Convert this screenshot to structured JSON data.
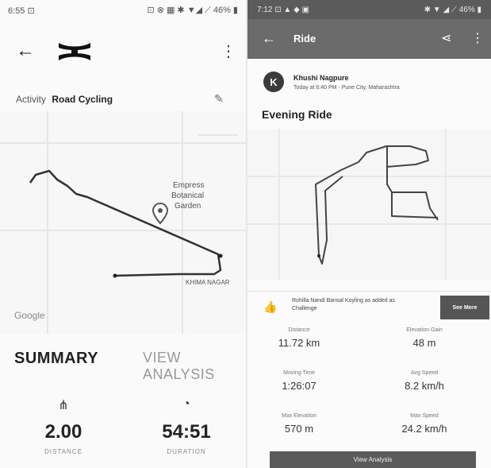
{
  "left": {
    "status": {
      "time": "6:55",
      "icons": "⊡",
      "right": "⊡ ⊗ ▦ ✱ ▼◢ ⟋ 46% ▮"
    },
    "activity_label": "Activity",
    "activity_value": "Road Cycling",
    "map": {
      "place_1": "Empress Botanical Garden",
      "place_1_lines": [
        "Empress",
        "Botanical",
        "Garden"
      ],
      "place_2": "KHIMA NAGAR",
      "google": "Google"
    },
    "summary_label": "SUMMARY",
    "view_analysis": "VIEW ANALYSIS",
    "stats": [
      {
        "icon": "route-icon",
        "value": "2.00",
        "label": "DISTANCE"
      },
      {
        "icon": "clock-icon",
        "value": "54:51",
        "label": "DURATION"
      }
    ]
  },
  "right": {
    "status": {
      "time": "7:12",
      "icons": "⊡ ▲ ◆ ▣",
      "right": "✱ ▼ ◢ ⟋ 46% ▮"
    },
    "title": "Ride",
    "avatar_letter": "K",
    "athlete_name": "Khushi Nagpure",
    "athlete_meta": "Today at 6:40 PM · Pune City, Maharashtra",
    "ride_title": "Evening Ride",
    "challenge_text": "Rohilla Nandi Bansal Koyling as added as Challenge",
    "see_button": "See More",
    "stats": [
      {
        "label": "Distance",
        "value": "11.72 km"
      },
      {
        "label": "Elevation Gain",
        "value": "48 m"
      },
      {
        "label": "Moving Time",
        "value": "1:26:07"
      },
      {
        "label": "Avg Speed",
        "value": "8.2 km/h"
      },
      {
        "label": "Max Elevation",
        "value": "570 m"
      },
      {
        "label": "Max Speed",
        "value": "24.2 km/h"
      }
    ],
    "footer": "View Analysis"
  }
}
